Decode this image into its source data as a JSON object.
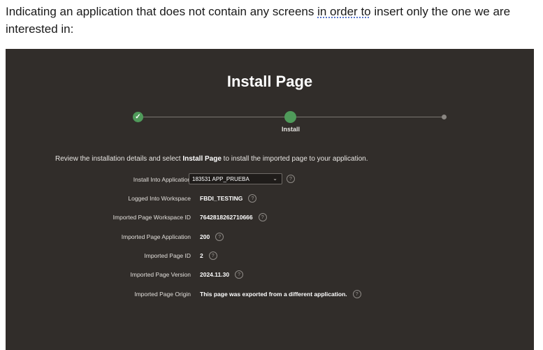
{
  "document": {
    "text_before": "Indicating an application that does not contain any screens ",
    "text_underlined": "in order to",
    "text_after": " insert only the one we are interested in:"
  },
  "app": {
    "page_title": "Install Page",
    "wizard": {
      "completed_check": "✓",
      "current_step_label": "Install"
    },
    "intro": {
      "before": "Review the installation details and select ",
      "bold": "Install Page",
      "after": " to install the imported page to your application."
    },
    "help_glyph": "?",
    "fields": {
      "install_into_application": {
        "label": "Install Into Application",
        "value": "183531 APP_PRUEBA"
      },
      "logged_into_workspace": {
        "label": "Logged Into Workspace",
        "value": "FBDI_TESTING"
      },
      "imported_page_workspace_id": {
        "label": "Imported Page Workspace ID",
        "value": "7642818262710666"
      },
      "imported_page_application": {
        "label": "Imported Page Application",
        "value": "200"
      },
      "imported_page_id": {
        "label": "Imported Page ID",
        "value": "2"
      },
      "imported_page_version": {
        "label": "Imported Page Version",
        "value": "2024.11.30"
      },
      "imported_page_origin": {
        "label": "Imported Page Origin",
        "value": "This page was exported from a different application."
      }
    },
    "colors": {
      "background": "#312d2a",
      "accent_green": "#4f9a5a"
    }
  }
}
